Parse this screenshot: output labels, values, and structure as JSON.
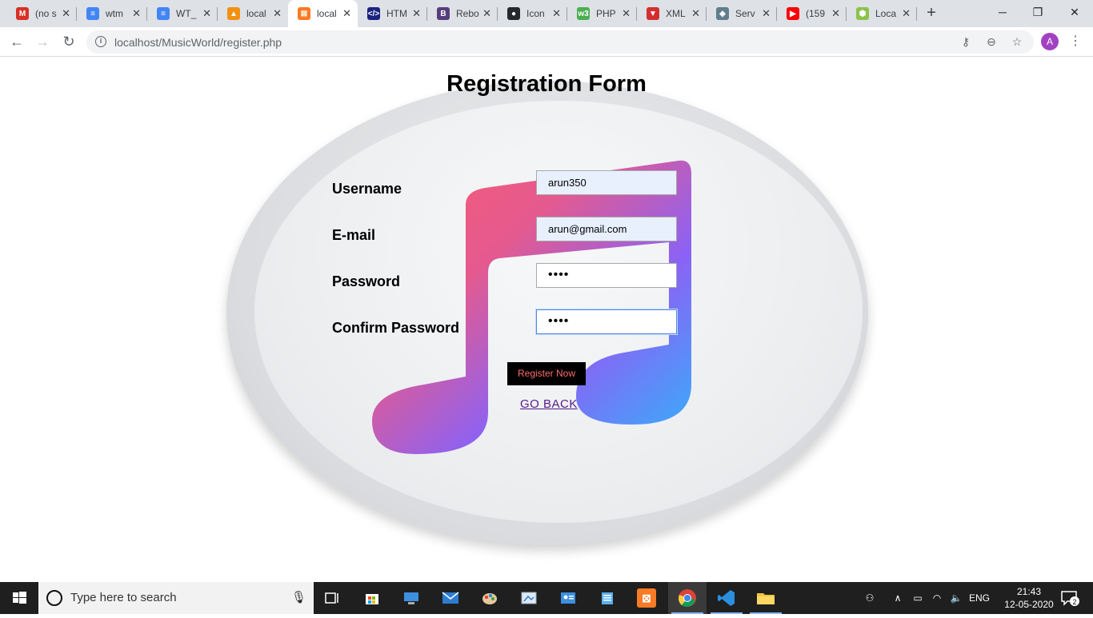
{
  "browser": {
    "tabs": [
      {
        "title": "(no s",
        "icon": "gmail-icon",
        "color": "#d93025",
        "glyph": "M"
      },
      {
        "title": "wtm",
        "icon": "docs-icon",
        "color": "#4285f4",
        "glyph": "≡"
      },
      {
        "title": "WT_",
        "icon": "docs-icon",
        "color": "#4285f4",
        "glyph": "≡"
      },
      {
        "title": "local",
        "icon": "phpmyadmin-icon",
        "color": "#f29111",
        "glyph": "▲"
      },
      {
        "title": "local",
        "icon": "xampp-icon",
        "color": "#fb7a24",
        "glyph": "⊠"
      },
      {
        "title": "HTM",
        "icon": "html-icon",
        "color": "#1a237e",
        "glyph": "</>"
      },
      {
        "title": "Rebo",
        "icon": "bootstrap-icon",
        "color": "#563d7c",
        "glyph": "B"
      },
      {
        "title": "Icon",
        "icon": "github-icon",
        "color": "#24292e",
        "glyph": "●"
      },
      {
        "title": "PHP",
        "icon": "w3schools-icon",
        "color": "#4caf50",
        "glyph": "w3"
      },
      {
        "title": "XML",
        "icon": "xml-icon",
        "color": "#d32f2f",
        "glyph": "▼"
      },
      {
        "title": "Serv",
        "icon": "server-icon",
        "color": "#607d8b",
        "glyph": "◈"
      },
      {
        "title": "(159",
        "icon": "youtube-icon",
        "color": "#ff0000",
        "glyph": "▶"
      },
      {
        "title": "Loca",
        "icon": "node-icon",
        "color": "#8bc34a",
        "glyph": "⬢"
      }
    ],
    "active_tab": 4,
    "url": "localhost/MusicWorld/register.php",
    "profile_initial": "A"
  },
  "page": {
    "title": "Registration Form",
    "fields": [
      {
        "label": "Username",
        "value": "arun350",
        "type": "text"
      },
      {
        "label": "E-mail",
        "value": "arun@gmail.com",
        "type": "text"
      },
      {
        "label": "Password",
        "value": "••••",
        "type": "password"
      },
      {
        "label": "Confirm Password",
        "value": "••••",
        "type": "password"
      }
    ],
    "submit_label": "Register Now",
    "back_link": "GO BACK"
  },
  "taskbar": {
    "search_placeholder": "Type here to search",
    "language": "ENG",
    "time": "21:43",
    "date": "12-05-2020",
    "notification_count": "2"
  }
}
